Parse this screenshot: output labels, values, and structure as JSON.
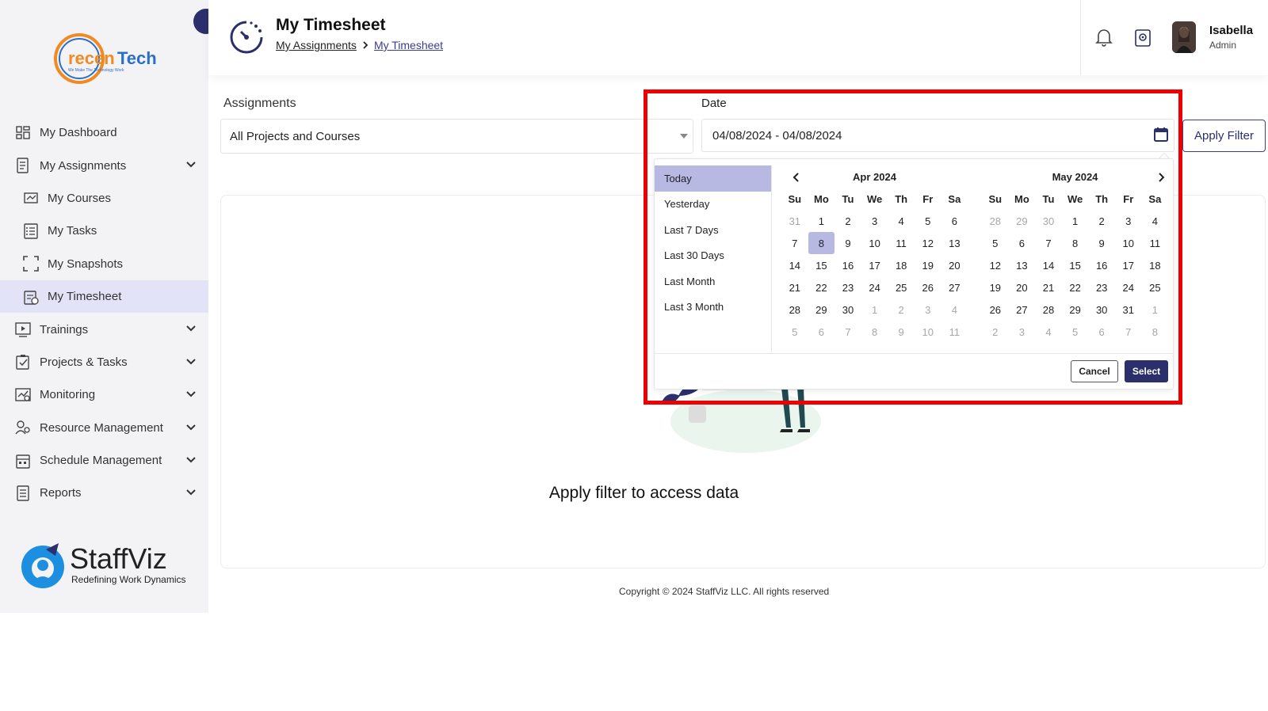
{
  "brand": {
    "top_logo_text": "recenTech",
    "top_logo_tagline": "We Make The Technology Work",
    "bottom_logo_text": "StaffViz",
    "bottom_logo_tagline": "Redefining Work Dynamics",
    "accent_color": "#2b2f6b",
    "highlight_color": "#ee0000"
  },
  "sidebar": {
    "items": [
      {
        "label": "My Dashboard",
        "icon": "dashboard-icon",
        "expandable": false
      },
      {
        "label": "My Assignments",
        "icon": "assignments-icon",
        "expandable": true
      },
      {
        "label": "My Courses",
        "icon": "courses-icon",
        "expandable": false,
        "sub": true
      },
      {
        "label": "My Tasks",
        "icon": "tasks-icon",
        "expandable": false,
        "sub": true
      },
      {
        "label": "My Snapshots",
        "icon": "snapshots-icon",
        "expandable": false,
        "sub": true
      },
      {
        "label": "My Timesheet",
        "icon": "timesheet-icon",
        "expandable": false,
        "sub": true,
        "active": true
      },
      {
        "label": "Trainings",
        "icon": "trainings-icon",
        "expandable": true
      },
      {
        "label": "Projects & Tasks",
        "icon": "projects-icon",
        "expandable": true
      },
      {
        "label": "Monitoring",
        "icon": "monitoring-icon",
        "expandable": true
      },
      {
        "label": "Resource Management",
        "icon": "resource-icon",
        "expandable": true
      },
      {
        "label": "Schedule Management",
        "icon": "schedule-icon",
        "expandable": true
      },
      {
        "label": "Reports",
        "icon": "reports-icon",
        "expandable": true
      }
    ]
  },
  "header": {
    "title": "My Timesheet",
    "breadcrumb": [
      "My Assignments",
      "My Timesheet"
    ],
    "user": {
      "name": "Isabella",
      "role": "Admin"
    }
  },
  "filters": {
    "assignments_label": "Assignments",
    "assignments_value": "All Projects and Courses",
    "date_label": "Date",
    "date_value": "04/08/2024 - 04/08/2024",
    "apply_label": "Apply Filter"
  },
  "datepicker": {
    "ranges": [
      "Today",
      "Yesterday",
      "Last 7 Days",
      "Last 30 Days",
      "Last Month",
      "Last 3 Month"
    ],
    "active_range": 0,
    "weekdays": [
      "Su",
      "Mo",
      "Tu",
      "We",
      "Th",
      "Fr",
      "Sa"
    ],
    "calendars": [
      {
        "title": "Apr 2024",
        "days": [
          [
            "31",
            1
          ],
          [
            "1",
            0
          ],
          [
            "2",
            0
          ],
          [
            "3",
            0
          ],
          [
            "4",
            0
          ],
          [
            "5",
            0
          ],
          [
            "6",
            0
          ],
          [
            "7",
            0
          ],
          [
            "8",
            2
          ],
          [
            "9",
            0
          ],
          [
            "10",
            0
          ],
          [
            "11",
            0
          ],
          [
            "12",
            0
          ],
          [
            "13",
            0
          ],
          [
            "14",
            0
          ],
          [
            "15",
            0
          ],
          [
            "16",
            0
          ],
          [
            "17",
            0
          ],
          [
            "18",
            0
          ],
          [
            "19",
            0
          ],
          [
            "20",
            0
          ],
          [
            "21",
            0
          ],
          [
            "22",
            0
          ],
          [
            "23",
            0
          ],
          [
            "24",
            0
          ],
          [
            "25",
            0
          ],
          [
            "26",
            0
          ],
          [
            "27",
            0
          ],
          [
            "28",
            0
          ],
          [
            "29",
            0
          ],
          [
            "30",
            0
          ],
          [
            "1",
            1
          ],
          [
            "2",
            1
          ],
          [
            "3",
            1
          ],
          [
            "4",
            1
          ],
          [
            "5",
            1
          ],
          [
            "6",
            1
          ],
          [
            "7",
            1
          ],
          [
            "8",
            1
          ],
          [
            "9",
            1
          ],
          [
            "10",
            1
          ],
          [
            "11",
            1
          ]
        ]
      },
      {
        "title": "May 2024",
        "days": [
          [
            "28",
            1
          ],
          [
            "29",
            1
          ],
          [
            "30",
            1
          ],
          [
            "1",
            0
          ],
          [
            "2",
            0
          ],
          [
            "3",
            0
          ],
          [
            "4",
            0
          ],
          [
            "5",
            0
          ],
          [
            "6",
            0
          ],
          [
            "7",
            0
          ],
          [
            "8",
            0
          ],
          [
            "9",
            0
          ],
          [
            "10",
            0
          ],
          [
            "11",
            0
          ],
          [
            "12",
            0
          ],
          [
            "13",
            0
          ],
          [
            "14",
            0
          ],
          [
            "15",
            0
          ],
          [
            "16",
            0
          ],
          [
            "17",
            0
          ],
          [
            "18",
            0
          ],
          [
            "19",
            0
          ],
          [
            "20",
            0
          ],
          [
            "21",
            0
          ],
          [
            "22",
            0
          ],
          [
            "23",
            0
          ],
          [
            "24",
            0
          ],
          [
            "25",
            0
          ],
          [
            "26",
            0
          ],
          [
            "27",
            0
          ],
          [
            "28",
            0
          ],
          [
            "29",
            0
          ],
          [
            "30",
            0
          ],
          [
            "31",
            0
          ],
          [
            "1",
            1
          ],
          [
            "2",
            1
          ],
          [
            "3",
            1
          ],
          [
            "4",
            1
          ],
          [
            "5",
            1
          ],
          [
            "6",
            1
          ],
          [
            "7",
            1
          ],
          [
            "8",
            1
          ]
        ]
      }
    ],
    "cancel_label": "Cancel",
    "select_label": "Select"
  },
  "content": {
    "empty_message": "Apply filter to access data"
  },
  "footer": {
    "copyright": "Copyright © 2024 StaffViz LLC. All rights reserved"
  }
}
